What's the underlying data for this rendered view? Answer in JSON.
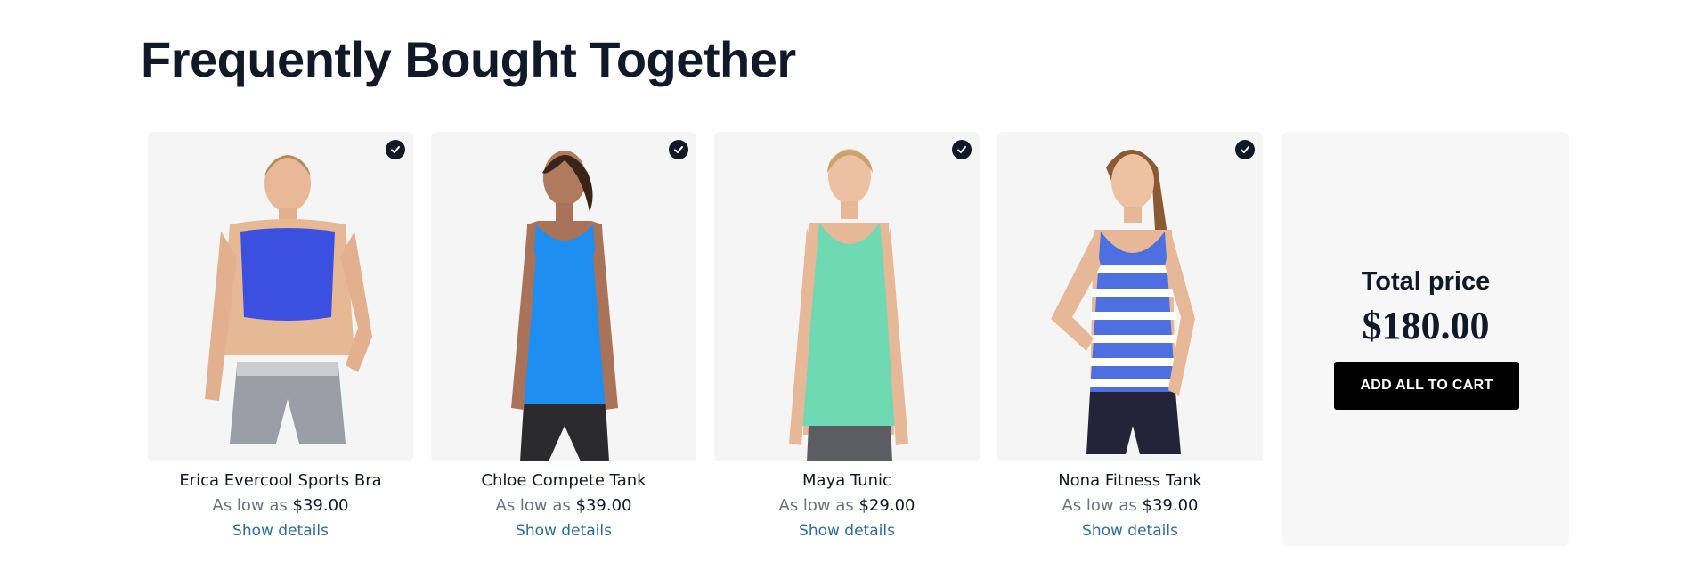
{
  "section": {
    "title": "Frequently Bought Together"
  },
  "products": [
    {
      "name": "Erica Evercool Sports Bra",
      "price_prefix": "As low as",
      "price": "$39.00",
      "details_label": "Show details",
      "selected": true,
      "top_color": "#3b4fe0",
      "bottom_color": "#9a9ea6"
    },
    {
      "name": "Chloe Compete Tank",
      "price_prefix": "As low as",
      "price": "$39.00",
      "details_label": "Show details",
      "selected": true,
      "top_color": "#1e8ff0",
      "bottom_color": "#2b2b2e"
    },
    {
      "name": "Maya Tunic",
      "price_prefix": "As low as",
      "price": "$29.00",
      "details_label": "Show details",
      "selected": true,
      "top_color": "#6fd9b3",
      "bottom_color": "#5b5d63"
    },
    {
      "name": "Nona Fitness Tank",
      "price_prefix": "As low as",
      "price": "$39.00",
      "details_label": "Show details",
      "selected": true,
      "top_color": "#4d6fe0",
      "bottom_color": "#23233a"
    }
  ],
  "summary": {
    "total_label": "Total price",
    "total_value": "$180.00",
    "add_all_label": "ADD ALL TO CART"
  },
  "icons": {
    "selected": "checkmark-circle-icon"
  },
  "colors": {
    "heading": "#111827",
    "link": "#2b6c9e",
    "button_bg": "#000000",
    "card_bg": "#f5f5f5"
  }
}
